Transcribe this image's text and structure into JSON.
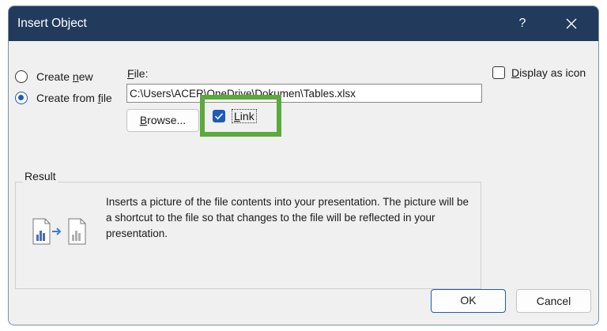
{
  "dialog": {
    "title": "Insert Object",
    "help_label": "?",
    "close_icon": "close-icon"
  },
  "options": {
    "create_new": {
      "access_key": "n",
      "prefix": "Create ",
      "rest": "ew",
      "selected": false
    },
    "create_from_file": {
      "prefix": "Create from ",
      "access_key": "f",
      "rest": "ile",
      "selected": true
    }
  },
  "file": {
    "label_key": "F",
    "label_rest": "ile:",
    "value": "C:\\Users\\ACER\\OneDrive\\Dokumen\\Tables.xlsx",
    "browse_key": "B",
    "browse_rest": "rowse...",
    "link_key": "L",
    "link_rest": "ink",
    "link_checked": true
  },
  "display_as_icon": {
    "key": "D",
    "rest": "isplay as icon",
    "checked": false
  },
  "result": {
    "title": "Result",
    "text": "Inserts a picture of the file contents into your presentation. The picture will be a shortcut to the file so that changes to the file will be reflected in your presentation.",
    "icon": "linked-file-icon"
  },
  "buttons": {
    "ok": "OK",
    "cancel": "Cancel"
  },
  "colors": {
    "titlebar": "#223b5c",
    "accent": "#1f5bb4",
    "highlight": "#5aaa3c"
  }
}
